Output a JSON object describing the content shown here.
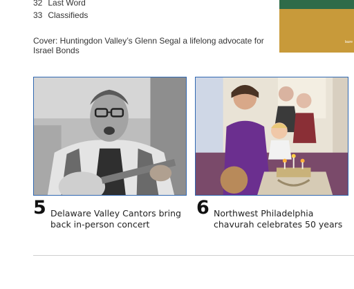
{
  "toc": [
    {
      "page": "32",
      "title": "Last Word"
    },
    {
      "page": "33",
      "title": "Classifieds"
    }
  ],
  "cover_caption": "Cover: Huntingdon Valley’s Glenn Segal a lifelong advocate for Israel Bonds",
  "cover_thumbnail": {
    "credit": "laure"
  },
  "stories": [
    {
      "page": "5",
      "headline": "Delaware Valley Cantors bring back in-person concert",
      "image": "cantor-with-guitar-photo"
    },
    {
      "page": "6",
      "headline": "Northwest Philadelphia chavurah celebrates 50 years",
      "image": "family-lighting-menorah-photo"
    }
  ],
  "colors": {
    "card_border": "#2f67b1",
    "cover_green": "#2f6b49",
    "cover_gold": "#c89a3a",
    "divider": "#cfcfcf"
  }
}
